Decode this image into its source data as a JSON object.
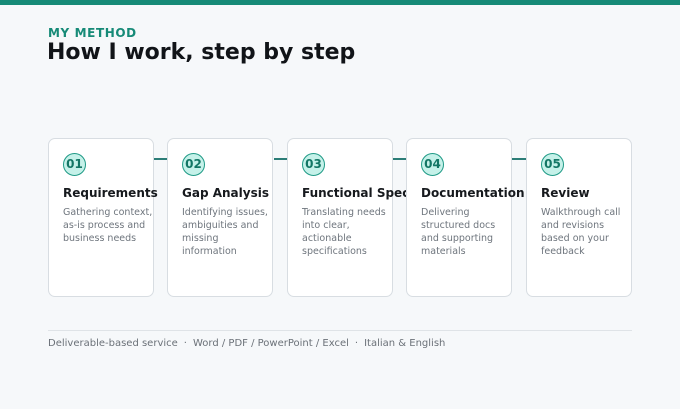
{
  "header": {
    "eyebrow": "MY METHOD",
    "title": "How I work, step by step"
  },
  "steps": [
    {
      "number": "01",
      "title": "Requirements",
      "description": "Gathering context, as-is process and business needs"
    },
    {
      "number": "02",
      "title": "Gap Analysis",
      "description": "Identifying issues, ambiguities and missing information"
    },
    {
      "number": "03",
      "title": "Functional Spec",
      "description": "Translating needs into clear, actionable specifications"
    },
    {
      "number": "04",
      "title": "Documentation",
      "description": "Delivering structured docs and supporting materials"
    },
    {
      "number": "05",
      "title": "Review",
      "description": "Walkthrough call and revisions based on your feedback"
    }
  ],
  "footer": {
    "items": [
      "Deliverable-based service",
      "Word / PDF / PowerPoint / Excel",
      "Italian & English"
    ],
    "separator": "·"
  },
  "colors": {
    "accent": "#168a77",
    "badge_fill": "#c5f1e9",
    "connector": "#2c7d77"
  }
}
